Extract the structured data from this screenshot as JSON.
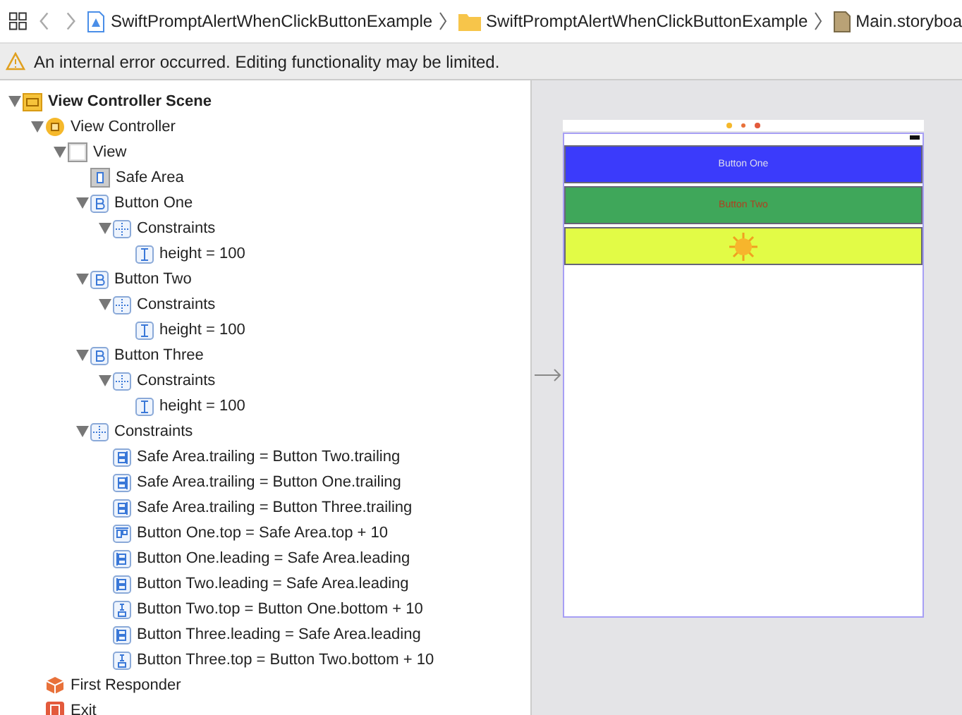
{
  "breadcrumbs": [
    {
      "kind": "project",
      "label": "SwiftPromptAlertWhenClickButtonExample"
    },
    {
      "kind": "folder",
      "label": "SwiftPromptAlertWhenClickButtonExample"
    },
    {
      "kind": "storyboard",
      "label": "Main.storyboa"
    }
  ],
  "warning": "An internal error occurred. Editing functionality may be limited.",
  "outline": [
    {
      "kind": "scene",
      "label": "View Controller Scene",
      "expanded": true,
      "children": [
        {
          "kind": "controller",
          "label": "View Controller",
          "expanded": true,
          "children": [
            {
              "kind": "view",
              "label": "View",
              "expanded": true,
              "children": [
                {
                  "kind": "safe-area",
                  "label": "Safe Area"
                },
                {
                  "kind": "button",
                  "label": "Button One",
                  "expanded": true,
                  "children": [
                    {
                      "kind": "constraints",
                      "label": "Constraints",
                      "expanded": true,
                      "children": [
                        {
                          "kind": "height",
                          "label": "height = 100"
                        }
                      ]
                    }
                  ]
                },
                {
                  "kind": "button",
                  "label": "Button Two",
                  "expanded": true,
                  "children": [
                    {
                      "kind": "constraints",
                      "label": "Constraints",
                      "expanded": true,
                      "children": [
                        {
                          "kind": "height",
                          "label": "height = 100"
                        }
                      ]
                    }
                  ]
                },
                {
                  "kind": "button",
                  "label": "Button Three",
                  "expanded": true,
                  "children": [
                    {
                      "kind": "constraints",
                      "label": "Constraints",
                      "expanded": true,
                      "children": [
                        {
                          "kind": "height",
                          "label": "height = 100"
                        }
                      ]
                    }
                  ]
                },
                {
                  "kind": "constraints",
                  "label": "Constraints",
                  "expanded": true,
                  "children": [
                    {
                      "kind": "trailing",
                      "label": "Safe Area.trailing = Button Two.trailing"
                    },
                    {
                      "kind": "trailing",
                      "label": "Safe Area.trailing = Button One.trailing"
                    },
                    {
                      "kind": "trailing",
                      "label": "Safe Area.trailing = Button Three.trailing"
                    },
                    {
                      "kind": "top",
                      "label": "Button One.top = Safe Area.top + 10"
                    },
                    {
                      "kind": "leading",
                      "label": "Button One.leading = Safe Area.leading"
                    },
                    {
                      "kind": "leading",
                      "label": "Button Two.leading = Safe Area.leading"
                    },
                    {
                      "kind": "vspace",
                      "label": "Button Two.top = Button One.bottom + 10"
                    },
                    {
                      "kind": "leading",
                      "label": "Button Three.leading = Safe Area.leading"
                    },
                    {
                      "kind": "vspace",
                      "label": "Button Three.top = Button Two.bottom + 10"
                    }
                  ]
                }
              ]
            }
          ]
        },
        {
          "kind": "responder",
          "label": "First Responder"
        },
        {
          "kind": "exit",
          "label": "Exit"
        }
      ]
    }
  ],
  "canvas": {
    "buttons": [
      {
        "kind": "text",
        "label": "Button One",
        "color": "#3b3bfb"
      },
      {
        "kind": "text",
        "label": "Button Two",
        "color": "#3fa75a"
      },
      {
        "kind": "image",
        "color": "#e2fb46"
      }
    ]
  }
}
